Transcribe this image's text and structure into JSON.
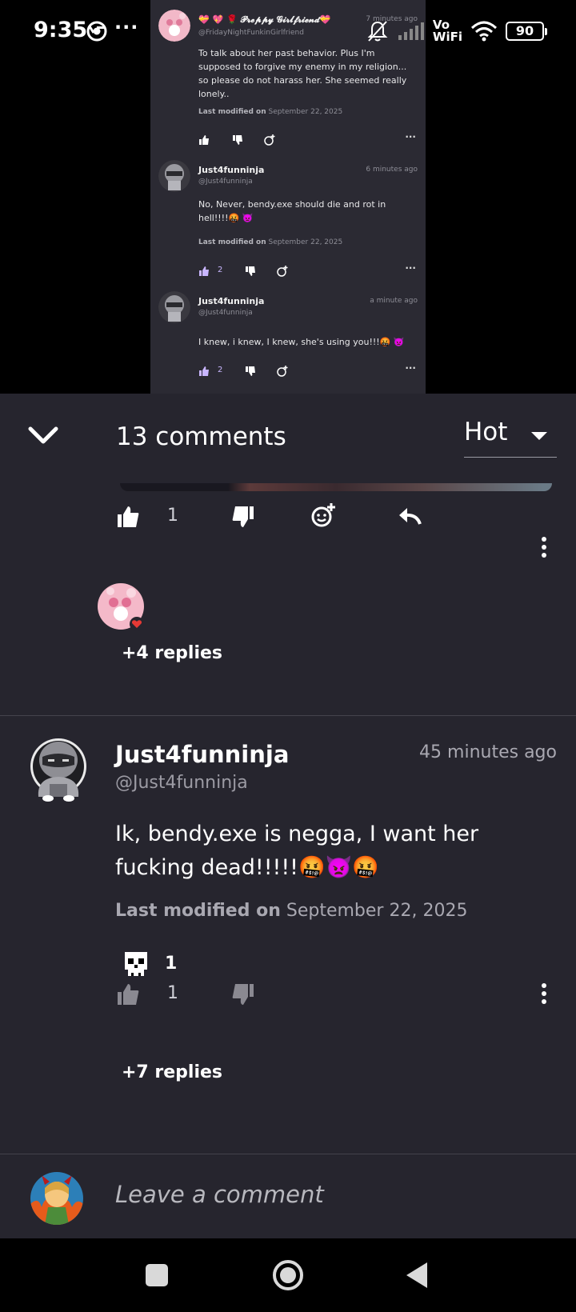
{
  "status_bar": {
    "time": "9:35",
    "overflow": "···",
    "vowifi_top": "Vo",
    "vowifi_bottom": "WiFi",
    "battery": "90",
    "icons": [
      "chrome-icon",
      "mute-icon",
      "signal-icon",
      "wifi-icon",
      "battery-icon"
    ]
  },
  "video": {
    "comments": [
      {
        "name": "💝 💖 🌹 𝓟𝓻𝓮𝓹𝓹𝔂 𝓖𝓲𝓻𝓵𝓯𝓻𝓲𝓮𝓷𝓭💝",
        "handle": "@FridayNightFunkinGirlfriend",
        "time": "7 minutes ago",
        "body": "To talk about her past behavior. Plus I'm supposed to forgive my enemy in my religion... so please do not harass her. She seemed really lonely..",
        "mod_label": "Last modified on",
        "mod_date": "September 22, 2025",
        "likes": ""
      },
      {
        "name": "Just4funninja",
        "handle": "@Just4funninja",
        "time": "6 minutes ago",
        "body": "No, Never, bendy.exe should die and rot in hell!!!!🤬 👿",
        "mod_label": "Last modified on",
        "mod_date": "September 22, 2025",
        "likes": "2"
      },
      {
        "name": "Just4funninja",
        "handle": "@Just4funninja",
        "time": "a minute ago",
        "body": "I knew, i knew, I knew, she's using you!!!🤬 👿",
        "likes": "2"
      }
    ]
  },
  "header": {
    "comment_count": "13 comments",
    "sort_label": "Hot"
  },
  "first_comment": {
    "likes": "1",
    "replies": "+4 replies"
  },
  "second_comment": {
    "name": "Just4funninja",
    "handle": "@Just4funninja",
    "time": "45 minutes ago",
    "body": "Ik, bendy.exe is negga, I want her fucking dead!!!!!🤬👿🤬",
    "mod_label": "Last modified on",
    "mod_date": "September 22, 2025",
    "reaction_count": "1",
    "likes": "1",
    "replies": "+7 replies"
  },
  "composer": {
    "placeholder": "Leave a comment"
  },
  "colors": {
    "panel_bg": "#26252e",
    "video_bg": "#2b2a33",
    "accent_like": "#c9b6ff",
    "muted_text": "#a9a8b1"
  }
}
